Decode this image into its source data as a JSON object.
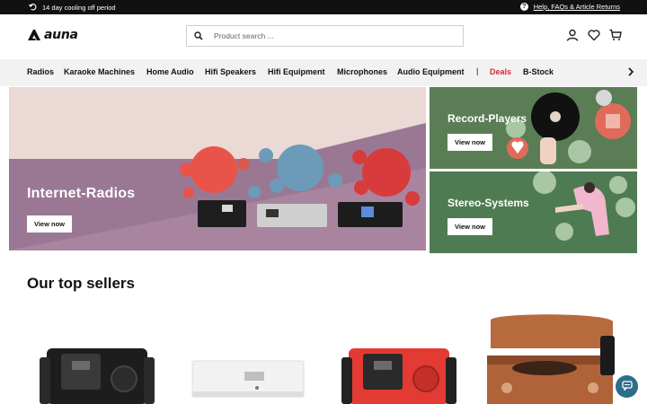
{
  "topbar": {
    "cooling_text": "14 day cooling off period",
    "help_text": "Help, FAQs & Article Returns"
  },
  "header": {
    "logo_text": "auna",
    "search_placeholder": "Product search ..."
  },
  "nav": {
    "items": [
      "Radios",
      "Karaoke Machines",
      "Home Audio",
      "Hifi Speakers",
      "Hifi Equipment",
      "Microphones",
      "Audio Equipment"
    ],
    "separator": "|",
    "deals": "Deals",
    "bstock": "B-Stock"
  },
  "hero": {
    "title": "Internet-Radios",
    "button": "View now"
  },
  "tiles": [
    {
      "title": "Record-Players",
      "button": "View now"
    },
    {
      "title": "Stereo-Systems",
      "button": "View now"
    }
  ],
  "sections": {
    "top_sellers": "Our top sellers"
  },
  "icons": {
    "cooling": "return-arrow-icon",
    "help": "question-icon",
    "search": "search-icon",
    "account": "user-icon",
    "wishlist": "heart-icon",
    "cart": "cart-icon",
    "nav_arrow": "chevron-right-icon",
    "chat": "chat-icon"
  },
  "colors": {
    "topbar": "#111111",
    "nav_bg": "#f2f2f2",
    "deals": "#d7263d",
    "record_tile": "#5a7d55",
    "stereo_tile": "#4f7b52",
    "hero_purple": "#9a7894",
    "chat_bubble": "#2d6f8a"
  }
}
